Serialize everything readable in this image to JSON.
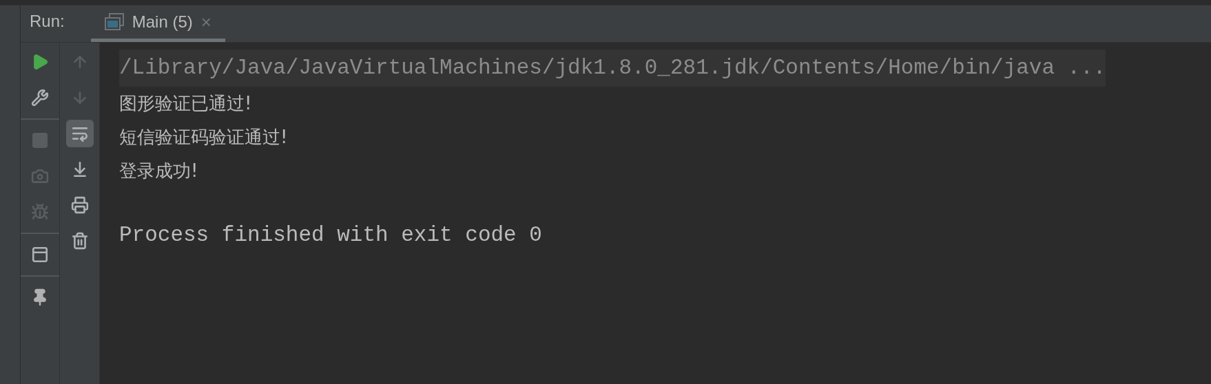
{
  "run_panel": {
    "label": "Run:",
    "tabs": [
      {
        "label": "Main (5)",
        "selected": true,
        "close": "×"
      }
    ],
    "left_toolbar": [
      [
        {
          "kind": "rerun",
          "disabled": false
        },
        {
          "kind": "settings",
          "disabled": false
        }
      ],
      [
        {
          "kind": "stop",
          "disabled": true
        },
        {
          "kind": "camera",
          "disabled": true
        },
        {
          "kind": "debug",
          "disabled": true
        }
      ],
      [
        {
          "kind": "layout",
          "disabled": false
        }
      ],
      [
        {
          "kind": "pin",
          "disabled": false
        }
      ]
    ],
    "console_toolbar": [
      {
        "kind": "up",
        "disabled": true,
        "selected": false
      },
      {
        "kind": "down",
        "disabled": true,
        "selected": false
      },
      {
        "kind": "wrap",
        "disabled": false,
        "selected": true
      },
      {
        "kind": "scroll-end",
        "disabled": false,
        "selected": false
      },
      {
        "kind": "print",
        "disabled": false,
        "selected": false
      },
      {
        "kind": "delete",
        "disabled": false,
        "selected": false
      }
    ],
    "console": [
      {
        "kind": "command",
        "text": "/Library/Java/JavaVirtualMachines/jdk1.8.0_281.jdk/Contents/Home/bin/java ..."
      },
      {
        "kind": "output",
        "text": "图形验证已通过!"
      },
      {
        "kind": "output",
        "text": "短信验证码验证通过!"
      },
      {
        "kind": "output",
        "text": "登录成功!"
      },
      {
        "kind": "exit",
        "text": "Process finished with exit code 0"
      }
    ]
  }
}
